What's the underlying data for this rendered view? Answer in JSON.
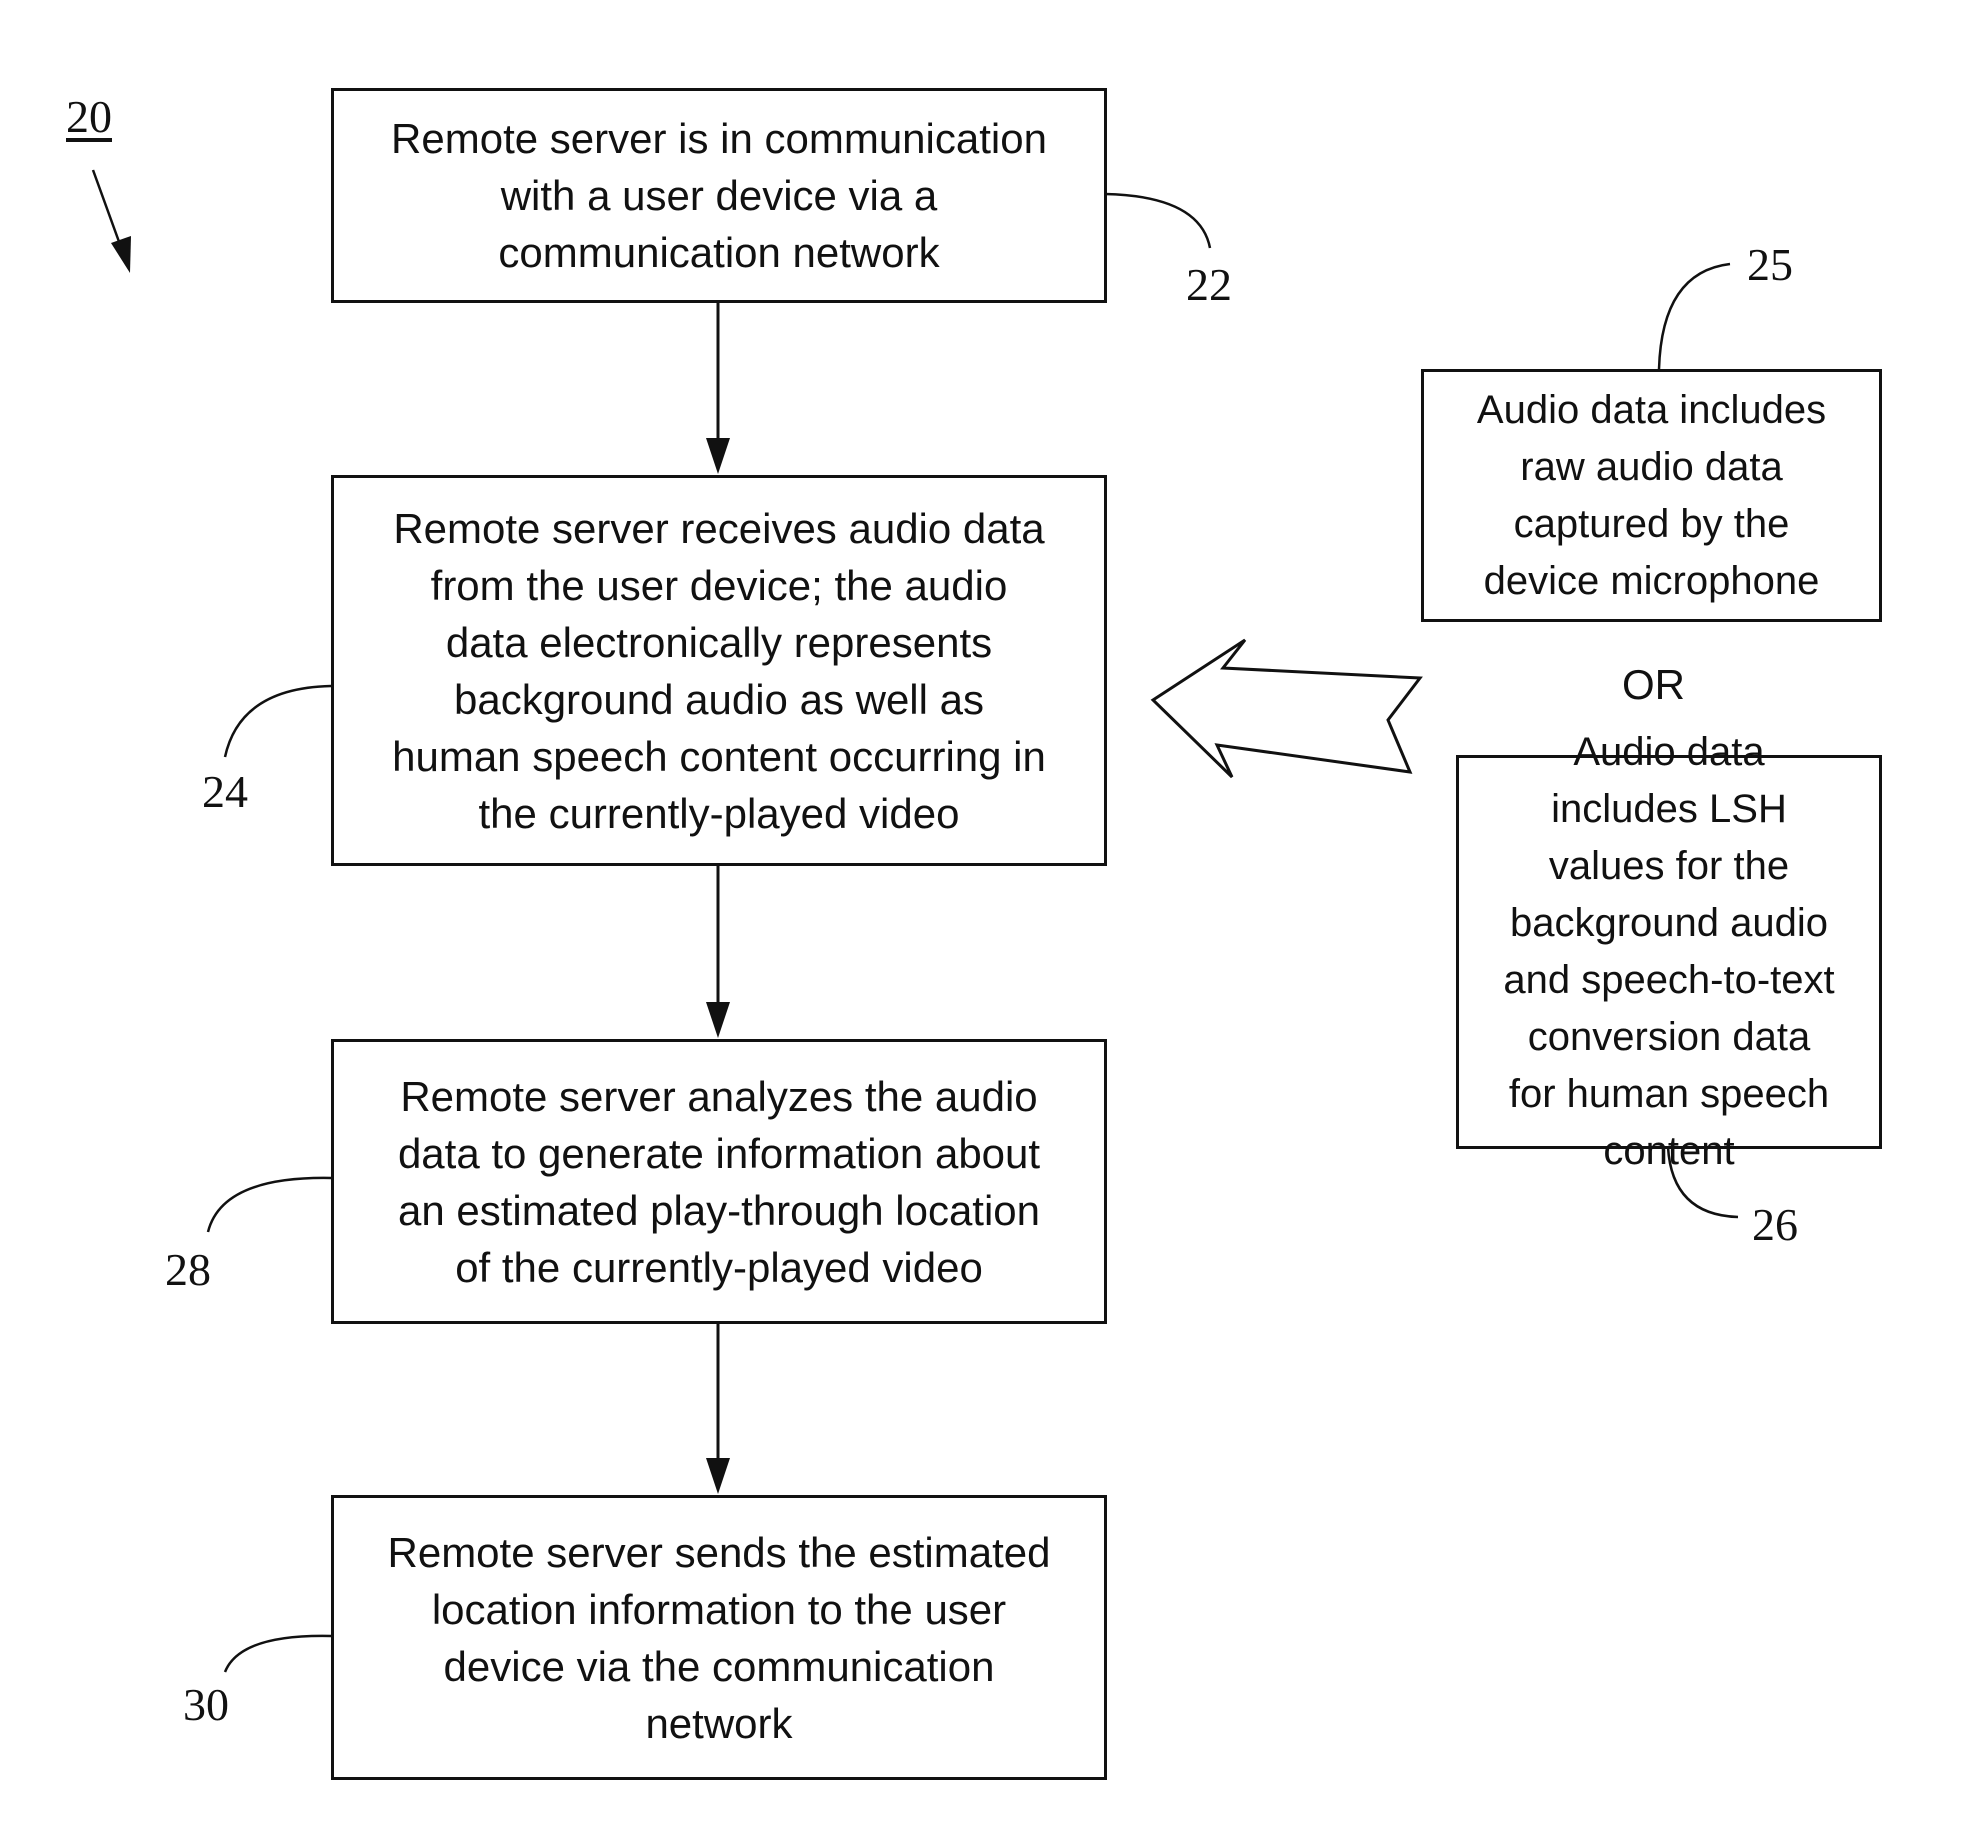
{
  "figure": {
    "label": "20",
    "type": "flowchart"
  },
  "steps": [
    {
      "ref": "22",
      "text": "Remote server is in communication\nwith a user device via a\ncommunication network"
    },
    {
      "ref": "24",
      "text": "Remote server receives audio data\nfrom the user device; the audio\ndata electronically represents\nbackground audio as well as\nhuman speech content occurring in\nthe currently-played video"
    },
    {
      "ref": "28",
      "text": "Remote server analyzes the audio\ndata to generate information about\nan estimated play-through location\nof the currently-played video"
    },
    {
      "ref": "30",
      "text": "Remote server sends the estimated\nlocation information to the user\ndevice via the communication\nnetwork"
    }
  ],
  "alternatives": {
    "separator": "OR",
    "options": [
      {
        "ref": "25",
        "text": "Audio data includes\nraw audio data\ncaptured by the\ndevice microphone"
      },
      {
        "ref": "26",
        "text": "Audio data\nincludes LSH\nvalues for the\nbackground audio\nand speech-to-text\nconversion data\nfor human speech\ncontent"
      }
    ]
  },
  "colors": {
    "ink": "#111111",
    "background": "#ffffff"
  }
}
